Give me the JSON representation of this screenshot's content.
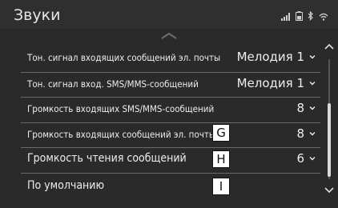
{
  "header": {
    "title": "Звуки"
  },
  "status_icons": [
    "signal-icon",
    "battery-icon",
    "bluetooth-icon",
    "wifi-icon"
  ],
  "rows": [
    {
      "label": "Тон. сигнал входящих сообщений эл. почты",
      "value": "Мелодия 1"
    },
    {
      "label": "Тон. сигнал вход. SMS/MMS-сообщений",
      "value": "Мелодия 1"
    },
    {
      "label": "Громкость входящих SMS/MMS-сообщений",
      "value": "8"
    },
    {
      "label": "Громкость входящих сообщений эл. почты",
      "value": "8"
    },
    {
      "label": "Громкость чтения сообщений",
      "value": "6"
    },
    {
      "label": "По умолчанию",
      "value": ""
    }
  ],
  "callouts": {
    "g": "G",
    "h": "H",
    "i": "I"
  },
  "colors": {
    "background": "#2a2a2a",
    "header": "#2f2f2f",
    "text": "#ededed",
    "separator": "#6a6a6a"
  }
}
